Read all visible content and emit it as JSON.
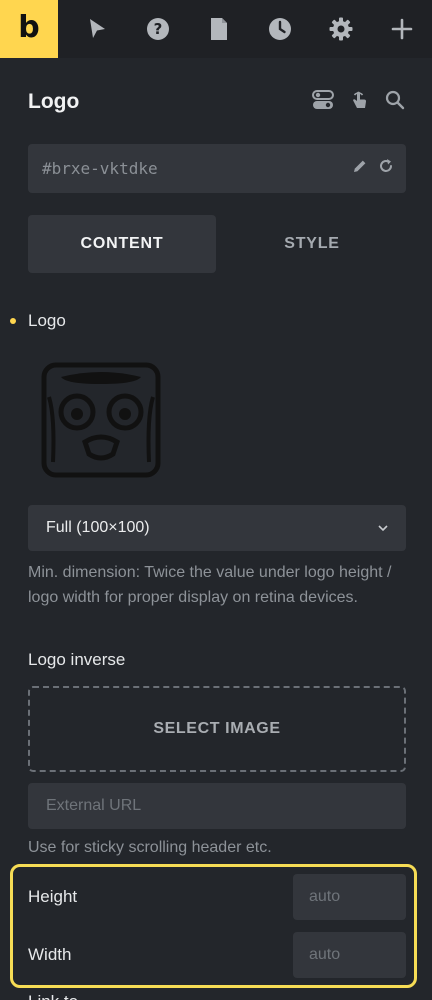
{
  "topbar": {
    "brand_letter": "b",
    "icons": [
      "cursor-icon",
      "help-icon",
      "page-icon",
      "history-icon",
      "settings-icon",
      "plus-icon"
    ]
  },
  "panel": {
    "title": "Logo",
    "header_icons": [
      "toggle-icon",
      "pointer-hand-icon",
      "search-icon"
    ]
  },
  "element_id": {
    "value": "#brxe-vktdke",
    "icons": [
      "pencil-icon",
      "refresh-icon"
    ]
  },
  "tabs": [
    {
      "label": "CONTENT",
      "active": true
    },
    {
      "label": "STYLE",
      "active": false
    }
  ],
  "logo_section": {
    "label": "Logo",
    "size_select": "Full (100×100)",
    "description": "Min. dimension: Twice the value under logo height / logo width for proper display on retina devices."
  },
  "logo_inverse": {
    "label": "Logo inverse",
    "select_image_label": "SELECT IMAGE",
    "external_url_placeholder": "External URL",
    "hint": "Use for sticky scrolling header etc."
  },
  "dimensions": {
    "height_label": "Height",
    "height_placeholder": "auto",
    "width_label": "Width",
    "width_placeholder": "auto"
  },
  "next_label": "Link to",
  "colors": {
    "accent": "#ffd64f",
    "highlight": "#f6dc55",
    "background": "#23262b",
    "field": "#33363c"
  }
}
